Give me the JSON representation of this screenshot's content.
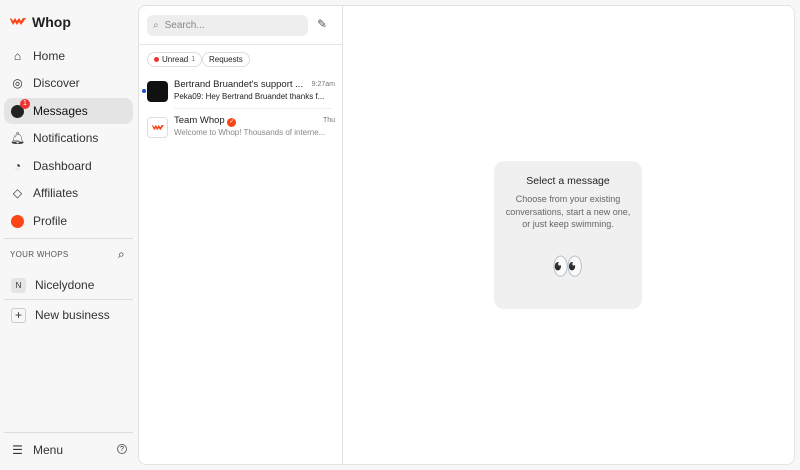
{
  "brand": {
    "name": "Whop",
    "accent": "#fa4616"
  },
  "nav": [
    {
      "label": "Home"
    },
    {
      "label": "Discover"
    },
    {
      "label": "Messages",
      "badge": "1"
    },
    {
      "label": "Notifications"
    },
    {
      "label": "Dashboard"
    },
    {
      "label": "Affiliates"
    },
    {
      "label": "Profile"
    }
  ],
  "your_whops": {
    "title": "YOUR WHOPS",
    "items": [
      {
        "initial": "N",
        "label": "Nicelydone"
      }
    ],
    "new_business": "New business"
  },
  "footer": {
    "menu": "Menu"
  },
  "search": {
    "placeholder": "Search..."
  },
  "filters": {
    "unread": "Unread",
    "unread_count": "1",
    "requests": "Requests"
  },
  "conversations": [
    {
      "name": "Bertrand Bruandet's support ...",
      "time": "9:27am",
      "preview": "Peka09: Hey Bertrand Bruandet thanks f...",
      "unread": true
    },
    {
      "name": "Team Whop",
      "time": "Thu",
      "preview": "Welcome to Whop! Thousands of interne...",
      "verified": true
    }
  ],
  "empty": {
    "title": "Select a message",
    "body": "Choose from your existing conversations, start a new one, or just keep swimming.",
    "emoji": "👀"
  }
}
